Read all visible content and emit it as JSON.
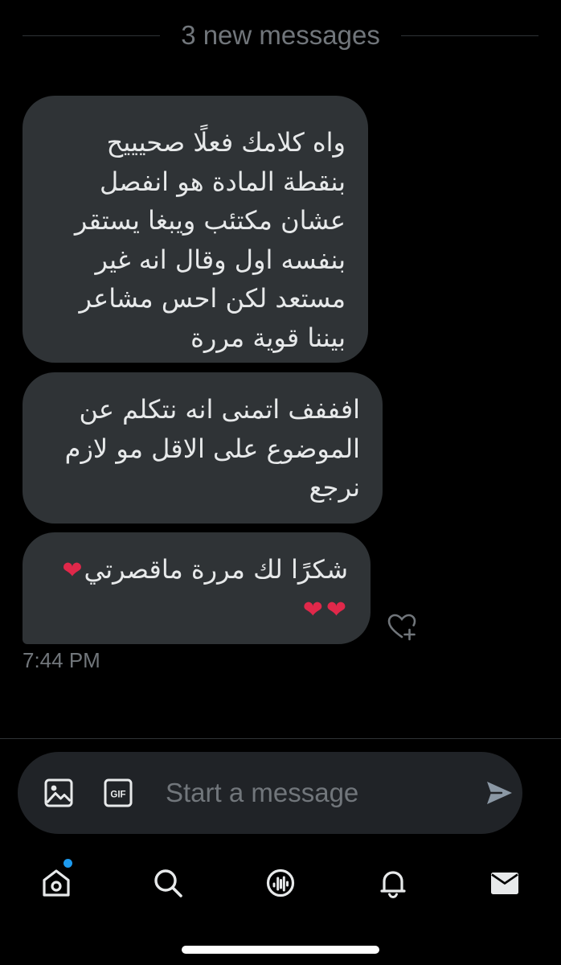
{
  "conversation": {
    "new_messages_divider": "3 new messages",
    "messages": [
      {
        "lines": [
          "واه كلامك فعلًا صحيييح",
          "بنقطة المادة هو انفصل",
          "عشان مكتئب ويبغا يستقر",
          "بنفسه اول وقال انه غير",
          "مستعد لكن احس مشاعر",
          "بيننا قوية مررة"
        ]
      },
      {
        "lines": [
          "افففف اتمنى انه نتكلم عن",
          "الموضوع على الاقل مو لازم",
          "نرجع"
        ]
      },
      {
        "line1": "شكرًا لك مررة ماقصرتي",
        "emoji_name": "mending-heart-emoji",
        "emoji_glyph": "❤",
        "emoji_count_line1": 1,
        "emoji_count_line2": 2
      }
    ],
    "timestamp": "7:44 PM"
  },
  "composer": {
    "placeholder": "Start a message",
    "icons": [
      "image-icon",
      "gif-icon",
      "send-icon"
    ],
    "gif_label": "GIF"
  },
  "tabbar": {
    "items": [
      "home",
      "search",
      "spaces",
      "notifications",
      "messages"
    ],
    "active": "messages",
    "home_has_notification_dot": true
  },
  "colors": {
    "background": "#000000",
    "bubble": "#2f3336",
    "text": "#e7e9ea",
    "muted": "#71767b",
    "accent": "#1d9bf0",
    "composer": "#202327"
  }
}
